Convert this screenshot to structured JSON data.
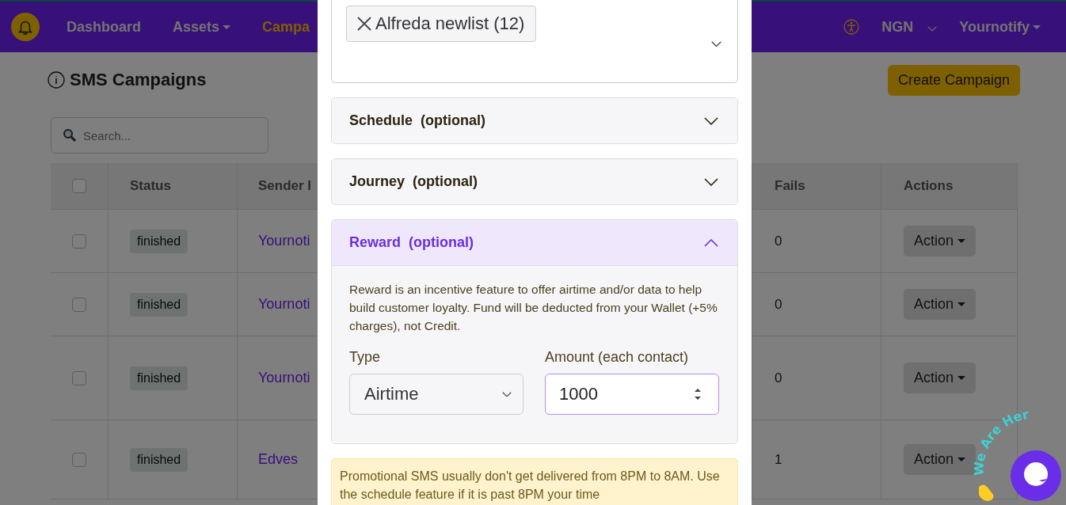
{
  "navbar": {
    "items": [
      {
        "label": "Dashboard",
        "selected": false,
        "dropdown": false
      },
      {
        "label": "Assets",
        "selected": false,
        "dropdown": true
      },
      {
        "label": "Campa",
        "selected": true,
        "dropdown": false
      }
    ],
    "currency": "NGN",
    "account": "Yournotify"
  },
  "page": {
    "title": "SMS Campaigns",
    "create_button": "Create Campaign",
    "search": {
      "placeholder": "Search..."
    }
  },
  "table": {
    "columns": [
      "Status",
      "Sender I",
      "Fails",
      "Actions"
    ],
    "header_checked": false,
    "rows": [
      {
        "checked": false,
        "status": "finished",
        "sender": "Yournoti",
        "fails": "0",
        "action": "Action"
      },
      {
        "checked": false,
        "status": "finished",
        "sender": "Yournoti",
        "fails": "0",
        "action": "Action"
      },
      {
        "checked": false,
        "status": "finished",
        "sender": "Yournoti",
        "fails": "0",
        "action": "Action"
      },
      {
        "checked": false,
        "status": "finished",
        "sender": "Edves",
        "fails": "1",
        "action": "Action"
      }
    ]
  },
  "modal": {
    "lists_chip": "Alfreda newlist (12)",
    "sections": [
      {
        "title": "Schedule",
        "hint": "(optional)",
        "expanded": false
      },
      {
        "title": "Journey",
        "hint": "(optional)",
        "expanded": false
      },
      {
        "title": "Reward",
        "hint": "(optional)",
        "expanded": true
      }
    ],
    "reward": {
      "description": "Reward is an incentive feature to offer airtime and/or data to help build customer loyalty. Fund will be deducted from your Wallet (+5% charges), not Credit.",
      "type_label": "Type",
      "type_value": "Airtime",
      "amount_label": "Amount (each contact)",
      "amount_value": "1000"
    },
    "warning": "Promotional SMS usually don't get delivered from 8PM to 8AM. Use the schedule feature if it is past 8PM your time"
  },
  "chat_widget": {
    "caption": "We Are Her"
  }
}
